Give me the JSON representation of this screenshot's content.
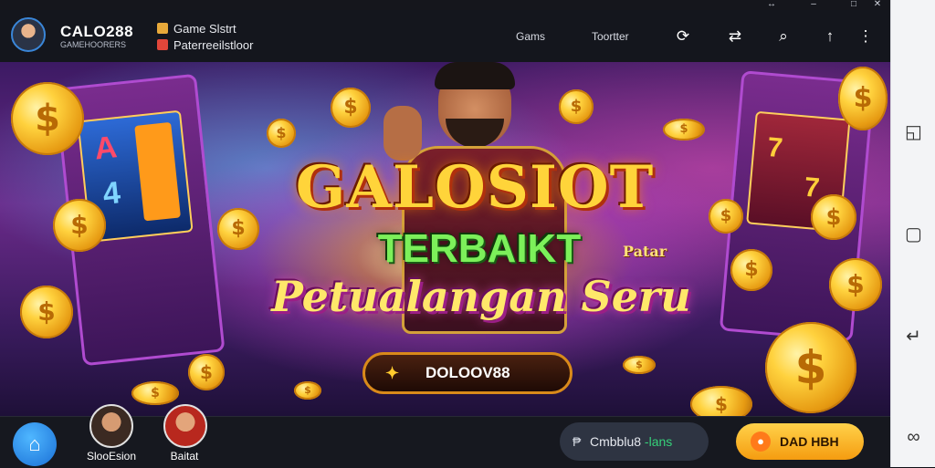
{
  "window": {
    "controls": [
      "↔",
      "–",
      "□",
      "✕"
    ]
  },
  "header": {
    "brand": "CALO288",
    "brand_sub": "GAMEHOORERS",
    "menu_items": [
      {
        "label": "Game Slstrt",
        "icon": "game-icon",
        "color": "#e8a93a"
      },
      {
        "label": "Paterreeilstloor",
        "icon": "promo-icon",
        "color": "#e2463a"
      }
    ],
    "nav": [
      "Gams",
      "Toortter"
    ],
    "icons": [
      "refresh-icon",
      "wallet-icon",
      "search-icon",
      "upload-icon",
      "more-icon"
    ],
    "icon_glyphs": [
      "⟳",
      "⇄",
      "⌕",
      "↑",
      "⋮"
    ]
  },
  "banner": {
    "title": "GALOSIOT",
    "subtitle": "TERBAIKT",
    "tag": "Patar",
    "tagline": "Petualangan Seru",
    "cta": "DOLOOV88",
    "slot_left": [
      "A",
      "4"
    ],
    "slot_right": [
      "7",
      "7"
    ]
  },
  "bottom": {
    "users": [
      {
        "name": "SlooEsion"
      },
      {
        "name": "Baitat"
      }
    ],
    "status_pill": {
      "icon": "₱",
      "label": "Cmbblu8",
      "suffix": "-lans"
    },
    "action_button": "DAD HBH"
  },
  "side_bar": {
    "icons": [
      "cast-icon",
      "square-icon",
      "back-icon",
      "link-icon"
    ],
    "glyphs": [
      "◱",
      "▢",
      "↵",
      "∞"
    ]
  },
  "colors": {
    "accent_gold": "#ffd24a",
    "accent_blue": "#1a6fd6",
    "header_bg": "#14161d"
  }
}
